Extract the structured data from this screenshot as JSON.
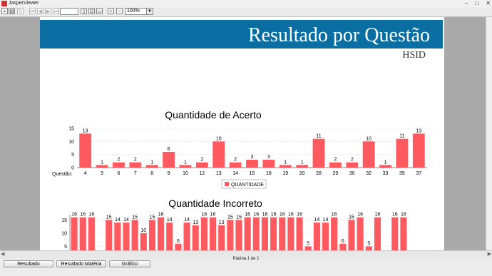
{
  "window": {
    "title": "JasperViewer",
    "controls": [
      "–",
      "□",
      "✕"
    ]
  },
  "toolbar": {
    "zoom_value": "100%"
  },
  "report": {
    "title": "Resultado por Questão",
    "subtitle": "HSID"
  },
  "chart_data": [
    {
      "type": "bar",
      "title": "Quantidade de Acerto",
      "xlabel": "Questão:",
      "legend": "QUANTIDADE",
      "legend_position": "bottom",
      "ylim": [
        0,
        15
      ],
      "yticks": [
        0,
        5,
        10,
        15
      ],
      "color": "#ff5a5f",
      "categories": [
        "4",
        "5",
        "6",
        "7",
        "8",
        "9",
        "10",
        "12",
        "13",
        "14",
        "15",
        "18",
        "19",
        "20",
        "28",
        "29",
        "30",
        "32",
        "33",
        "35",
        "37"
      ],
      "values": [
        13,
        1,
        2,
        2,
        1,
        6,
        1,
        2,
        10,
        2,
        3,
        3,
        1,
        1,
        11,
        2,
        2,
        10,
        1,
        11,
        13
      ]
    },
    {
      "type": "bar",
      "title": "Quantidade Incorreto",
      "ylim": [
        0,
        17
      ],
      "yticks": [
        5,
        10,
        15
      ],
      "color": "#ff5a5f",
      "values": [
        16,
        16,
        16,
        0,
        15,
        14,
        14,
        15,
        10,
        15,
        16,
        14,
        6,
        14,
        13,
        16,
        16,
        13,
        15,
        15,
        16,
        16,
        16,
        16,
        16,
        16,
        16,
        5,
        14,
        14,
        16,
        6,
        15,
        16,
        5,
        16,
        0,
        16,
        16
      ]
    }
  ],
  "status": {
    "page_text": "Página 1 de 1"
  },
  "buttons": {
    "resultado": "Resultado",
    "resultado_materia": "Resultado Matéria",
    "grafico": "Gráfico"
  }
}
